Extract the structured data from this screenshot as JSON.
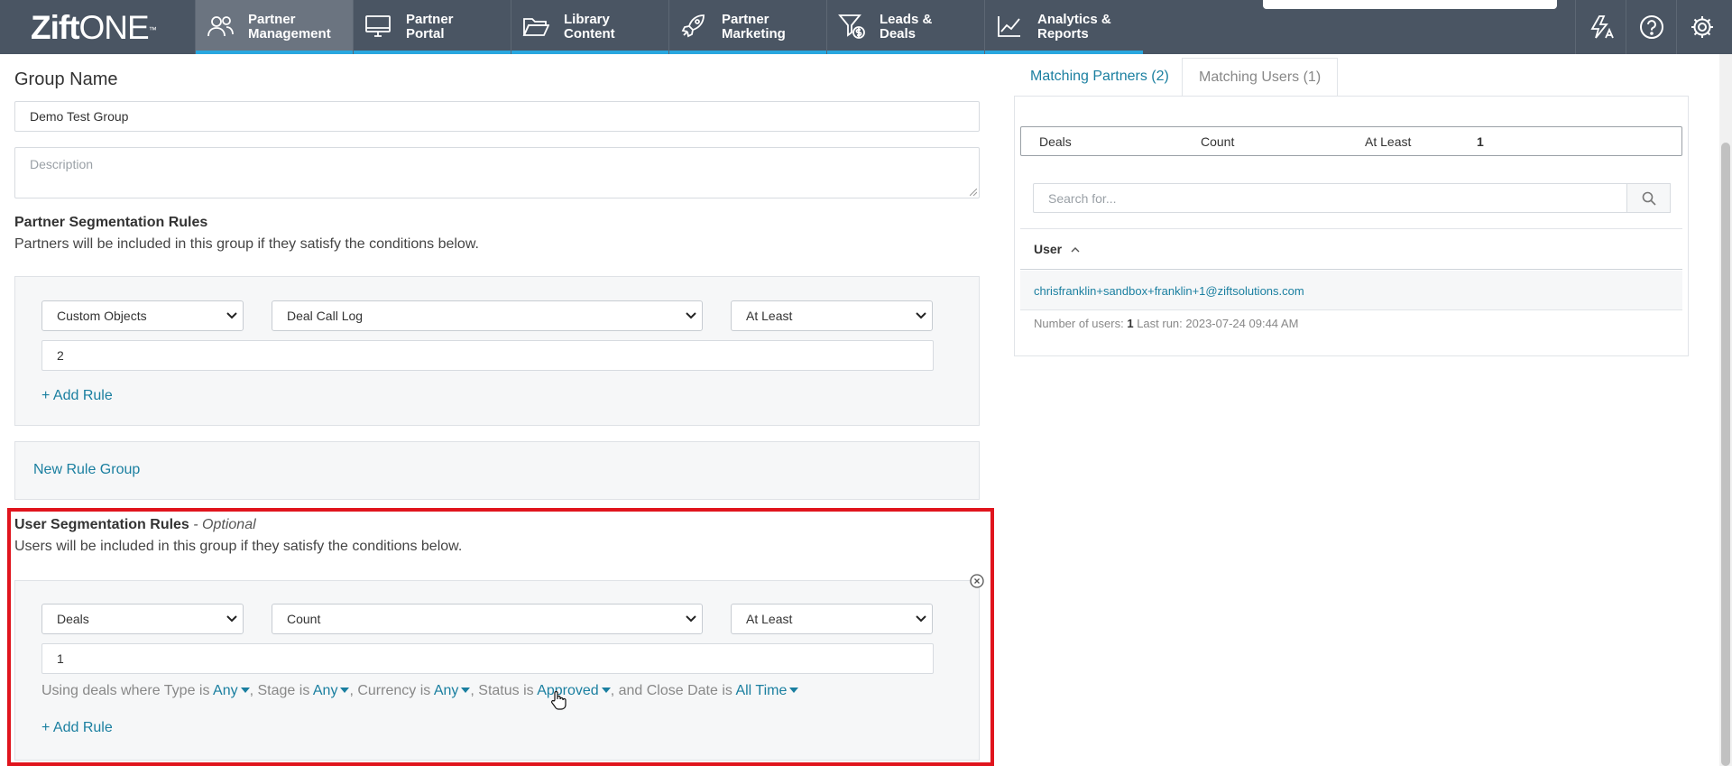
{
  "app": {
    "logo_bold": "Zift",
    "logo_light": "ONE",
    "logo_tm": "™"
  },
  "nav": {
    "tabs": [
      {
        "line1": "Partner",
        "line2": "Management",
        "icon": "users-icon"
      },
      {
        "line1": "Partner",
        "line2": "Portal",
        "icon": "monitor-icon"
      },
      {
        "line1": "Library",
        "line2": "Content",
        "icon": "folder-icon"
      },
      {
        "line1": "Partner",
        "line2": "Marketing",
        "icon": "rocket-icon"
      },
      {
        "line1": "Leads &",
        "line2": "Deals",
        "icon": "funnel-dollar-icon"
      },
      {
        "line1": "Analytics &",
        "line2": "Reports",
        "icon": "chart-icon"
      }
    ],
    "right_icons": [
      "translate-icon",
      "help-icon",
      "gear-icon"
    ]
  },
  "form": {
    "group_name_label": "Group Name",
    "group_name_value": "Demo Test Group",
    "description_placeholder": "Description",
    "partner_rules": {
      "title": "Partner Segmentation Rules",
      "desc": "Partners will be included in this group if they satisfy the conditions below.",
      "select1": "Custom Objects",
      "select2": "Deal Call Log",
      "select3": "At Least",
      "value": "2",
      "add_rule": "+ Add Rule"
    },
    "new_rule_group": "New Rule Group",
    "user_rules": {
      "title": "User Segmentation Rules",
      "optional": "- Optional",
      "desc": "Users will be included in this group if they satisfy the conditions below.",
      "select1": "Deals",
      "select2": "Count",
      "select3": "At Least",
      "value": "1",
      "cond_prefix": "Using deals where Type is",
      "type_val": "Any",
      "stage_label": ", Stage is",
      "stage_val": "Any",
      "currency_label": ", Currency is",
      "currency_val": "Any",
      "status_label": ", Status is",
      "status_val": "Approved",
      "close_label": ", and Close Date is",
      "close_val": "All Time",
      "add_rule": "+ Add Rule"
    }
  },
  "right": {
    "tab_partners": "Matching Partners (2)",
    "tab_users": "Matching Users (1)",
    "summary": {
      "c1": "Deals",
      "c2": "Count",
      "c3": "At Least",
      "c4": "1"
    },
    "search_placeholder": "Search for...",
    "column_user": "User",
    "users": [
      "chrisfranklin+sandbox+franklin+1@ziftsolutions.com"
    ],
    "footer_label": "Number of users:",
    "footer_count": "1",
    "footer_run": "Last run: 2023-07-24 09:44 AM"
  },
  "colors": {
    "topbar": "#4a5563",
    "accent_bar": "#29a7df",
    "link": "#1a7fa0",
    "highlight": "#e0141d"
  }
}
